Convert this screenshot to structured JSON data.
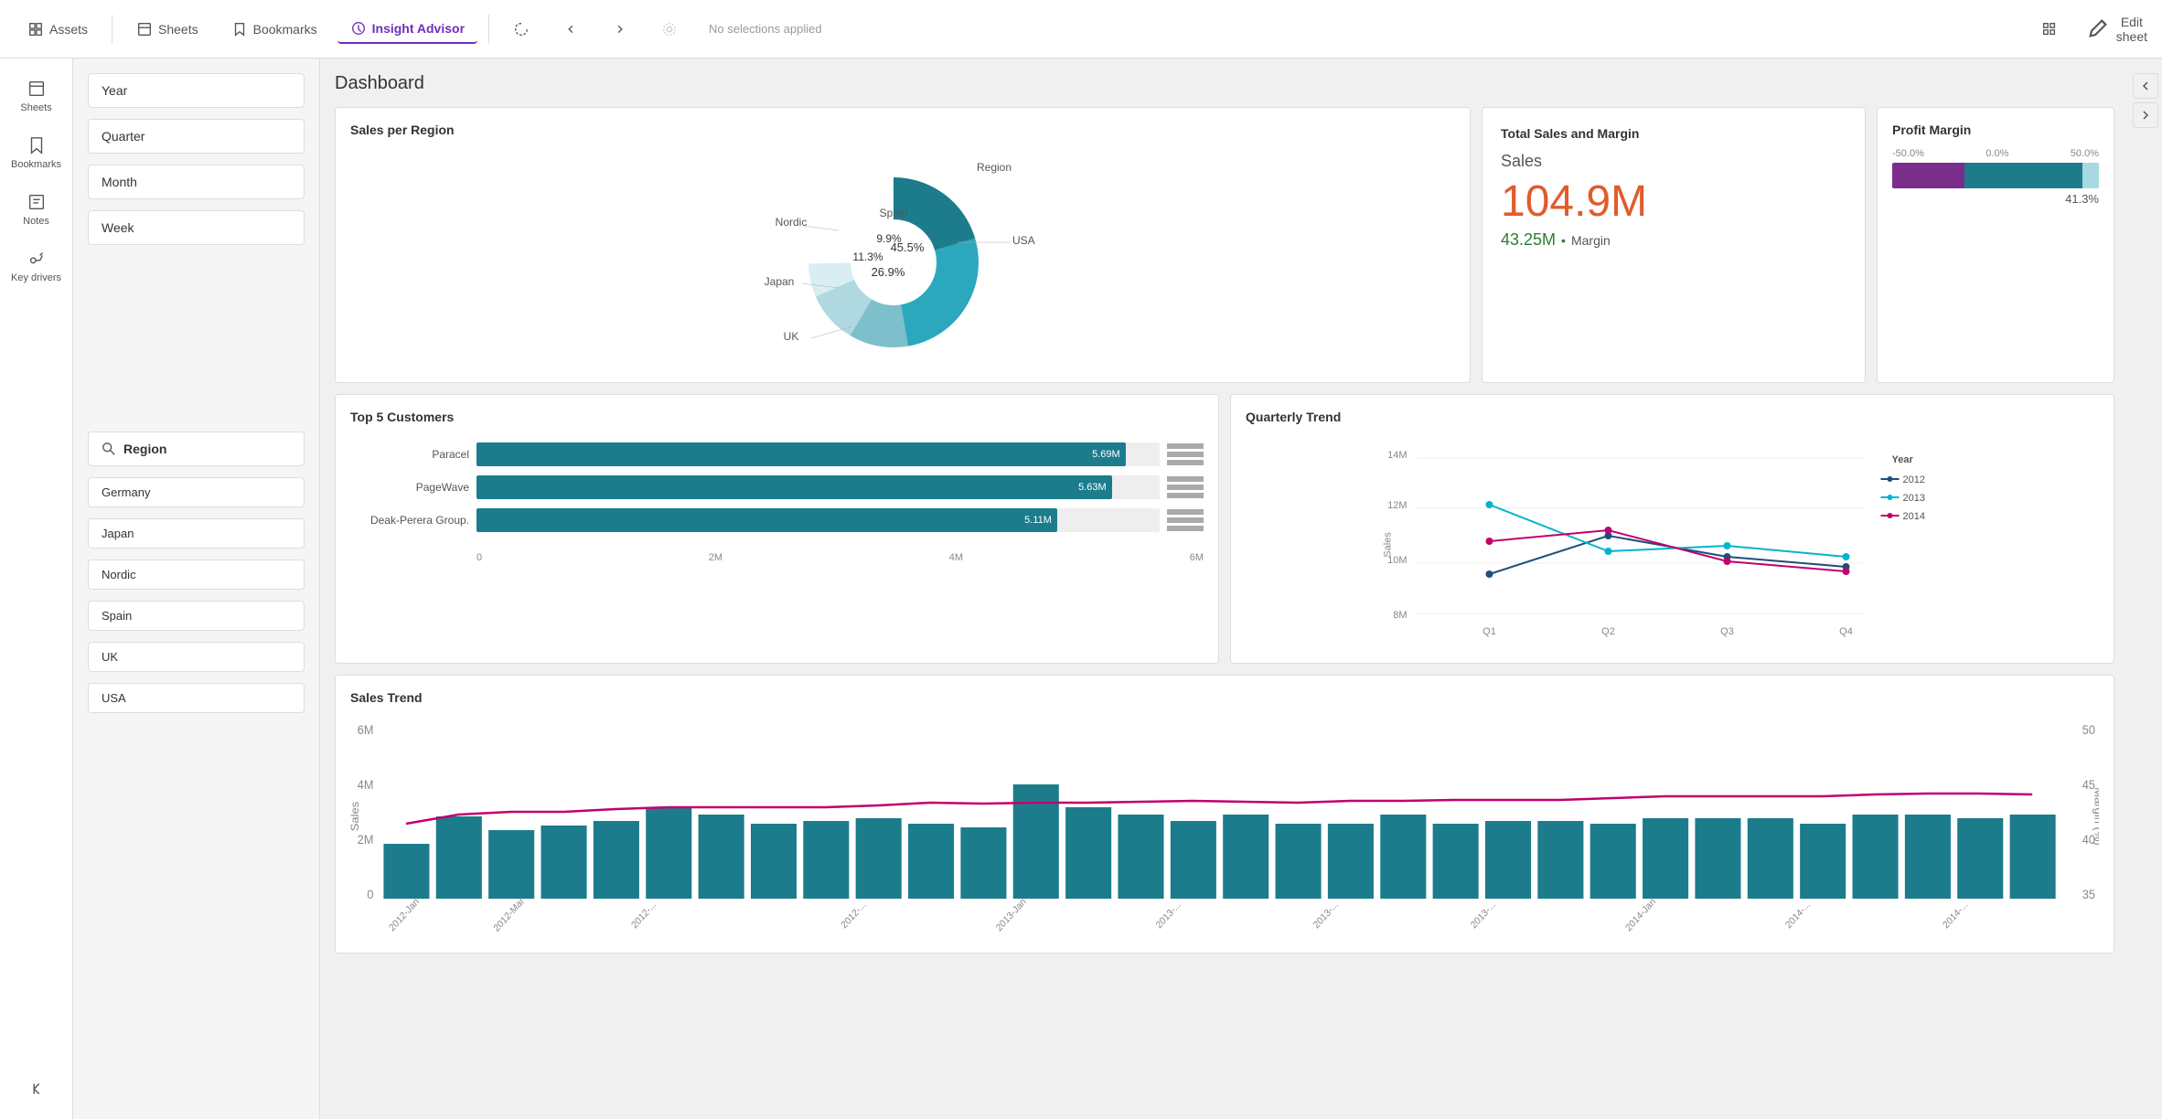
{
  "topnav": {
    "assets_label": "Assets",
    "sheets_label": "Sheets",
    "bookmarks_label": "Bookmarks",
    "insight_advisor_label": "Insight Advisor",
    "no_selections": "No selections applied",
    "edit_sheet_label": "Edit sheet"
  },
  "sidebar": {
    "items": [
      {
        "label": "Sheets",
        "icon": "sheets-icon"
      },
      {
        "label": "Bookmarks",
        "icon": "bookmarks-icon"
      },
      {
        "label": "Notes",
        "icon": "notes-icon"
      },
      {
        "label": "Key drivers",
        "icon": "key-drivers-icon"
      }
    ]
  },
  "filters": {
    "items": [
      {
        "label": "Year"
      },
      {
        "label": "Quarter"
      },
      {
        "label": "Month"
      },
      {
        "label": "Week"
      }
    ],
    "region_label": "Region",
    "region_items": [
      "Germany",
      "Japan",
      "Nordic",
      "Spain",
      "UK",
      "USA"
    ]
  },
  "page": {
    "title": "Dashboard"
  },
  "sales_per_region": {
    "title": "Sales per Region",
    "legend_label": "Region",
    "segments": [
      {
        "label": "USA",
        "value": 45.5,
        "color": "#1c7c8c"
      },
      {
        "label": "UK",
        "value": 26.9,
        "color": "#2ba8be"
      },
      {
        "label": "Japan",
        "value": 11.3,
        "color": "#7dbfca"
      },
      {
        "label": "Nordic",
        "value": 9.9,
        "color": "#b0d8e0"
      },
      {
        "label": "Spain",
        "value": 6.4,
        "color": "#cce8ed"
      }
    ]
  },
  "total_sales": {
    "title": "Total Sales and Margin",
    "sales_label": "Sales",
    "sales_value": "104.9M",
    "margin_value": "43.25M",
    "margin_label": "Margin"
  },
  "profit_margin": {
    "title": "Profit Margin",
    "scale_left": "-50.0%",
    "scale_mid": "0.0%",
    "scale_right": "50.0%",
    "percentage": "41.3%"
  },
  "top5_customers": {
    "title": "Top 5 Customers",
    "customers": [
      {
        "name": "Paracel",
        "value": 5.69,
        "label": "5.69M",
        "pct": 95
      },
      {
        "name": "PageWave",
        "value": 5.63,
        "label": "5.63M",
        "pct": 93
      },
      {
        "name": "Deak-Perera Group.",
        "value": 5.11,
        "label": "5.11M",
        "pct": 85
      }
    ],
    "axis": [
      "0",
      "2M",
      "4M",
      "6M"
    ]
  },
  "quarterly_trend": {
    "title": "Quarterly Trend",
    "y_label": "Sales",
    "x_labels": [
      "Q1",
      "Q2",
      "Q3",
      "Q4"
    ],
    "y_ticks": [
      "8M",
      "10M",
      "12M",
      "14M"
    ],
    "legend_title": "Year",
    "series": [
      {
        "year": "2012",
        "color": "#1f4e79",
        "points": [
          9.5,
          11.0,
          10.2,
          9.8
        ]
      },
      {
        "year": "2013",
        "color": "#00b5cc",
        "points": [
          12.2,
          10.4,
          10.6,
          10.2
        ]
      },
      {
        "year": "2014",
        "color": "#c0006e",
        "points": [
          10.8,
          11.2,
          10.0,
          9.6
        ]
      }
    ]
  },
  "sales_trend": {
    "title": "Sales Trend",
    "y_label": "Sales",
    "y2_label": "Margin (%)",
    "bar_color": "#1c7c8c",
    "line_color": "#c0006e"
  },
  "colors": {
    "accent_purple": "#6c2fbb",
    "teal": "#1c7c8c",
    "orange": "#e05c2c"
  }
}
